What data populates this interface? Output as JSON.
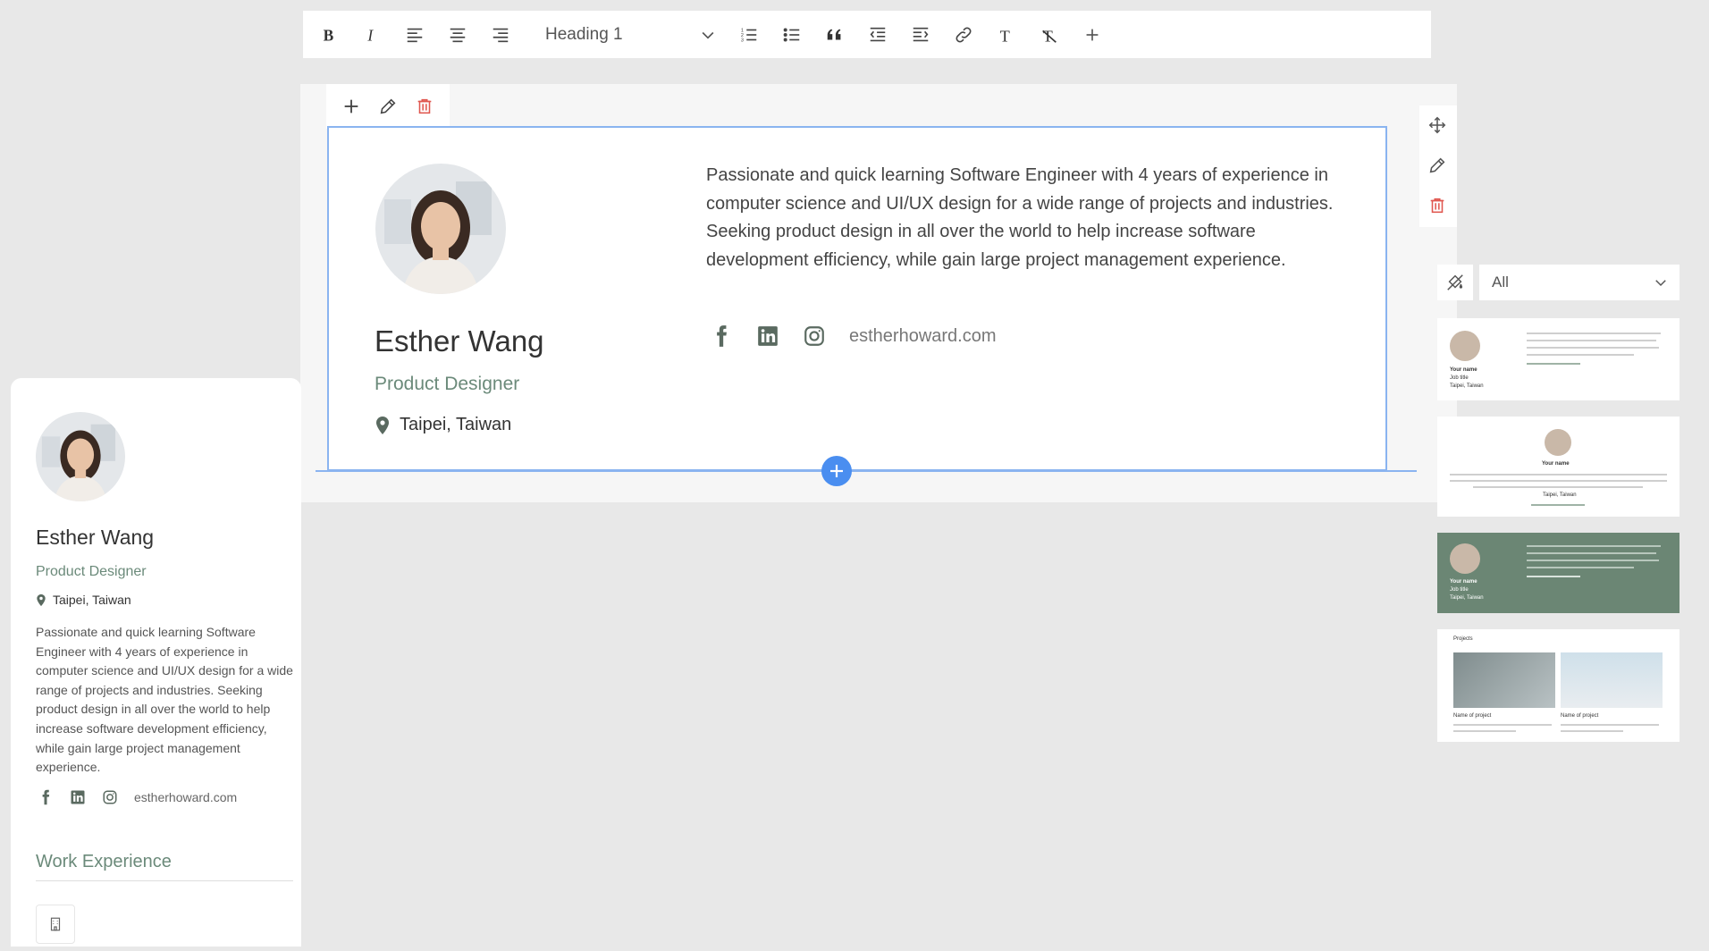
{
  "toolbar": {
    "buttons": [
      "bold",
      "italic",
      "align-left",
      "align-center",
      "align-right"
    ],
    "heading_value": "Heading 1",
    "buttons_after": [
      "ordered-list",
      "unordered-list",
      "blockquote",
      "outdent",
      "indent",
      "link",
      "text-format",
      "clear-format",
      "add"
    ]
  },
  "profile": {
    "name": "Esther Wang",
    "role": "Product Designer",
    "location": "Taipei, Taiwan",
    "bio": "Passionate and quick learning Software Engineer with 4 years of experience in computer science and UI/UX design for a wide range of projects and industries. Seeking product design in all over the world to help increase software development efficiency, while gain large project management experience.",
    "website": "estherhoward.com"
  },
  "sidebar_card": {
    "work_experience_title": "Work Experience"
  },
  "templates": {
    "filter_value": "All",
    "thumb_placeholders": {
      "your_name": "Your name",
      "job_title": "Job title",
      "location": "Taipei, Taiwan",
      "projects_title": "Projects",
      "project_name": "Name of project"
    }
  },
  "colors": {
    "accent_green": "#6b8a7a",
    "selection_blue": "#8ab4f0",
    "insert_blue": "#4a8ef0",
    "delete_red": "#e0574f",
    "dark_template": "#6b8674"
  }
}
